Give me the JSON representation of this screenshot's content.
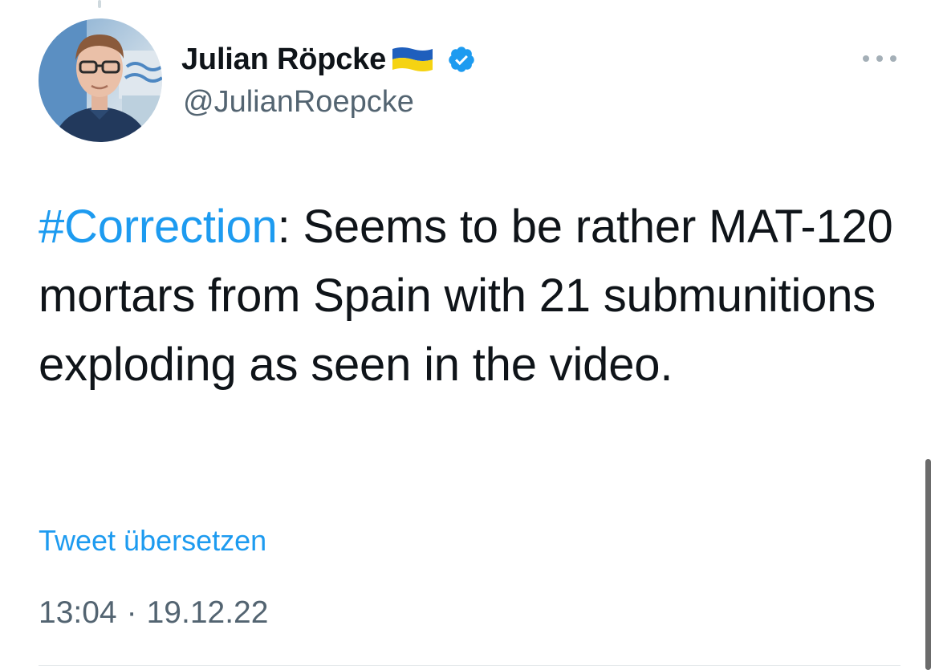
{
  "author": {
    "display_name": "Julian Röpcke",
    "handle": "@JulianRoepcke",
    "flag": "ukraine-flag",
    "verified": true
  },
  "tweet": {
    "hashtag": "#Correction",
    "text_after_hashtag": ": Seems to be rather MAT-120 mortars from Spain with 21 submunitions exploding as seen in the video.",
    "translate_label": "Tweet übersetzen",
    "time": "13:04",
    "separator": "·",
    "date": "19.12.22"
  },
  "colors": {
    "link": "#1d9bf0",
    "text": "#0f1419",
    "secondary": "#536471",
    "flag_blue": "#1f5fbd",
    "flag_yellow": "#f5d312"
  }
}
